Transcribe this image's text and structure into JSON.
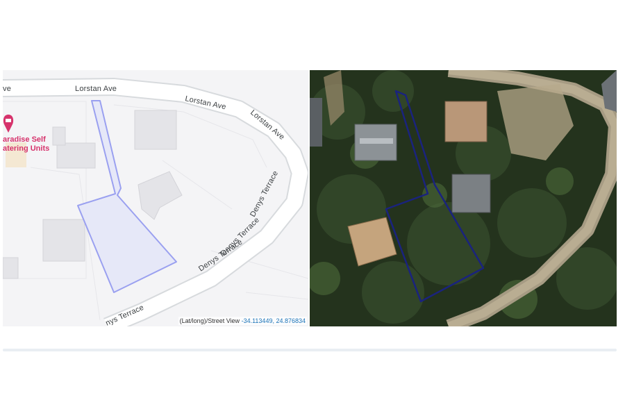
{
  "map": {
    "streets": {
      "lorstan_left": "ve",
      "lorstan_1": "Lorstan Ave",
      "lorstan_2": "Lorstan Ave",
      "lorstan_3": "Lorstan Ave",
      "denys_1": "Denys Terrace",
      "denys_2": "Denys Terrace",
      "denys_3": "Denys Terrace",
      "denys_bottom": "nys Terrace"
    },
    "poi": {
      "line1": "aradise Self",
      "line2": "atering Units",
      "icon": "lodging-pin-icon",
      "color": "#d6336c"
    },
    "parcel_color": "#9aa0f0",
    "coord_label": "(Lat/long)/Street View",
    "coords": "-34.113449, 24.876834"
  },
  "satellite": {
    "parcel_outline_color": "#1a237e"
  }
}
